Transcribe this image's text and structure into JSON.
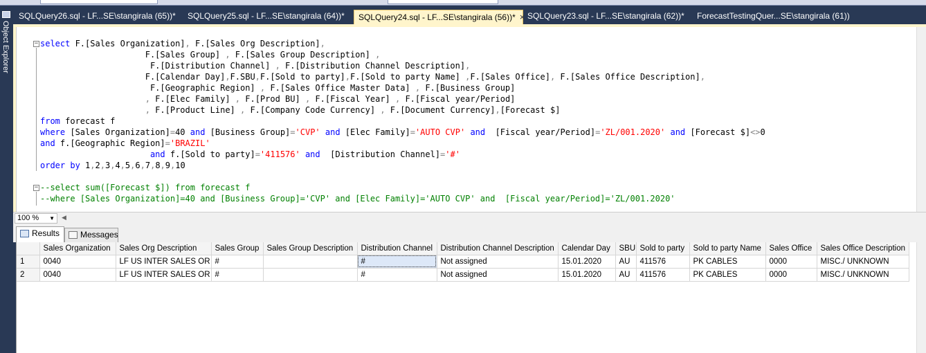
{
  "window": {
    "side_panel_label": "Object Explorer"
  },
  "tabs": [
    {
      "label": "SQLQuery26.sql - LF...SE\\stangirala (65))*",
      "active": false
    },
    {
      "label": "SQLQuery25.sql - LF...SE\\stangirala (64))*",
      "active": false
    },
    {
      "label": "SQLQuery24.sql - LF...SE\\stangirala (56))*",
      "active": true
    },
    {
      "label": "SQLQuery23.sql - LF...SE\\stangirala (62))*",
      "active": false
    },
    {
      "label": "ForecastTestingQuer...SE\\stangirala (61))",
      "active": false
    }
  ],
  "tab_close_icon": "×",
  "editor": {
    "lines": [
      "select F.[Sales Organization], F.[Sales Org Description],",
      "                     F.[Sales Group] , F.[Sales Group Description] ,",
      "                      F.[Distribution Channel] , F.[Distribution Channel Description],",
      "                     F.[Calendar Day],F.SBU,F.[Sold to party],F.[Sold to party Name] ,F.[Sales Office], F.[Sales Office Description],",
      "                      F.[Geographic Region] , F.[Sales Office Master Data] , F.[Business Group]",
      "                     , F.[Elec Family] , F.[Prod BU] , F.[Fiscal Year] , F.[Fiscal year/Period]",
      "                     , F.[Product Line] , F.[Company Code Currency] , F.[Document Currency],[Forecast $]",
      "from forecast f",
      "where [Sales Organization]=40 and [Business Group]='CVP' and [Elec Family]='AUTO CVP' and  [Fiscal year/Period]='ZL/001.2020' and [Forecast $]<>0",
      "and f.[Geographic Region]='BRAZIL'",
      "                      and f.[Sold to party]='411576' and  [Distribution Channel]='#'",
      "order by 1,2,3,4,5,6,7,8,9,10",
      "",
      "--select sum([Forecast $]) from forecast f",
      "--where [Sales Organization]=40 and [Business Group]='CVP' and [Elec Family]='AUTO CVP' and  [Fiscal year/Period]='ZL/001.2020'"
    ],
    "collapse_symbol": "−"
  },
  "zoom": {
    "value": "100 %"
  },
  "results_tabs": [
    {
      "label": "Results",
      "active": true,
      "icon": "grid-icon"
    },
    {
      "label": "Messages",
      "active": false,
      "icon": "messages-icon"
    }
  ],
  "grid": {
    "columns": [
      "",
      "Sales Organization",
      "Sales Org Description",
      "Sales Group",
      "Sales Group Description",
      "Distribution Channel",
      "Distribution Channel Description",
      "Calendar Day",
      "SBU",
      "Sold to party",
      "Sold to party Name",
      "Sales Office",
      "Sales Office Description"
    ],
    "rows": [
      [
        "1",
        "0040",
        "LF US INTER SALES OR",
        "#",
        "",
        "#",
        "Not assigned",
        "15.01.2020",
        "AU",
        "411576",
        "PK CABLES",
        "0000",
        "MISC./ UNKNOWN"
      ],
      [
        "2",
        "0040",
        "LF US INTER SALES OR",
        "#",
        "",
        "#",
        "Not assigned",
        "15.01.2020",
        "AU",
        "411576",
        "PK CABLES",
        "0000",
        "MISC./ UNKNOWN"
      ]
    ]
  }
}
